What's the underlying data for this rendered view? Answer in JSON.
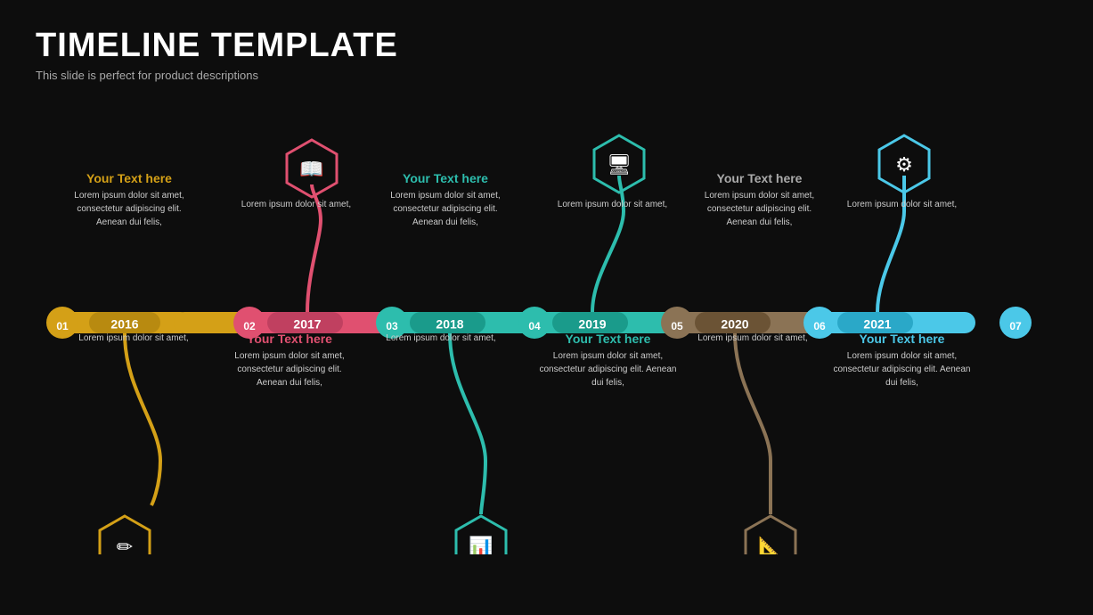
{
  "header": {
    "title": "TIMELINE TEMPLATE",
    "subtitle": "This slide is perfect for product descriptions"
  },
  "colors": {
    "yellow": "#D4A017",
    "red": "#E05070",
    "teal": "#2DBDAD",
    "teal2": "#2DBDAD",
    "brown": "#8B7355",
    "blue": "#4BC8E8",
    "dark_yellow": "#C8940A",
    "dark_red": "#C04060",
    "dark_teal": "#1A9B8B",
    "dark_brown": "#6B5335",
    "dark_blue": "#2AA8C8"
  },
  "items": [
    {
      "number": "01",
      "year": "2016",
      "color": "#D4A017",
      "dark_color": "#B88A10",
      "position": "bottom",
      "heading": "Your  Text here",
      "heading_color": "#D4A017",
      "top_text": "Lorem ipsum dolor sit amet, consectetur adipiscing elit. Aenean  dui felis,",
      "bottom_text": "Lorem ipsum dolor sit amet,",
      "icon": "✏️",
      "icon_char": "✏"
    },
    {
      "number": "02",
      "year": "2017",
      "color": "#E05070",
      "dark_color": "#C04060",
      "position": "top",
      "heading": "Your  Text here",
      "heading_color": "#E05070",
      "top_text": "Lorem ipsum dolor sit amet,",
      "bottom_text": "Lorem ipsum dolor sit amet, consectetur adipiscing elit. Aenean  dui felis,",
      "icon": "📖",
      "icon_char": "📖"
    },
    {
      "number": "03",
      "year": "2018",
      "color": "#2DBDAD",
      "dark_color": "#1A9B8B",
      "position": "bottom",
      "heading": "Your  Text here",
      "heading_color": "#2DBDAD",
      "top_text": "Lorem ipsum dolor sit amet, consectetur adipiscing elit. Aenean  dui felis,",
      "bottom_text": "Lorem ipsum dolor sit amet,",
      "icon": "📊",
      "icon_char": "📊"
    },
    {
      "number": "04",
      "year": "2019",
      "color": "#2DBDAD",
      "dark_color": "#1A9B8B",
      "position": "top",
      "heading": "Your  Text here",
      "heading_color": "#2DBDAD",
      "top_text": "Lorem ipsum dolor sit amet,",
      "bottom_text": "Lorem ipsum dolor sit amet, consectetur adipiscing elit. Aenean  dui felis,",
      "icon": "🖥️",
      "icon_char": "🖥"
    },
    {
      "number": "05",
      "year": "2020",
      "color": "#8B7355",
      "dark_color": "#6B5335",
      "position": "bottom",
      "heading": "Your  Text here",
      "heading_color": "#aaaaaa",
      "top_text": "Lorem ipsum dolor sit amet, consectetur adipiscing elit. Aenean  dui felis,",
      "bottom_text": "Lorem ipsum dolor sit amet,",
      "icon": "📐",
      "icon_char": "📐"
    },
    {
      "number": "06",
      "year": "2021",
      "color": "#4BC8E8",
      "dark_color": "#2AA8C8",
      "position": "top",
      "heading": "Your  Text here",
      "heading_color": "#4BC8E8",
      "top_text": "Lorem ipsum dolor sit amet,",
      "bottom_text": "Lorem ipsum dolor sit amet, consectetur adipiscing elit. Aenean  dui felis,",
      "icon": "⚙️",
      "icon_char": "⚙"
    }
  ],
  "end_number": "07"
}
